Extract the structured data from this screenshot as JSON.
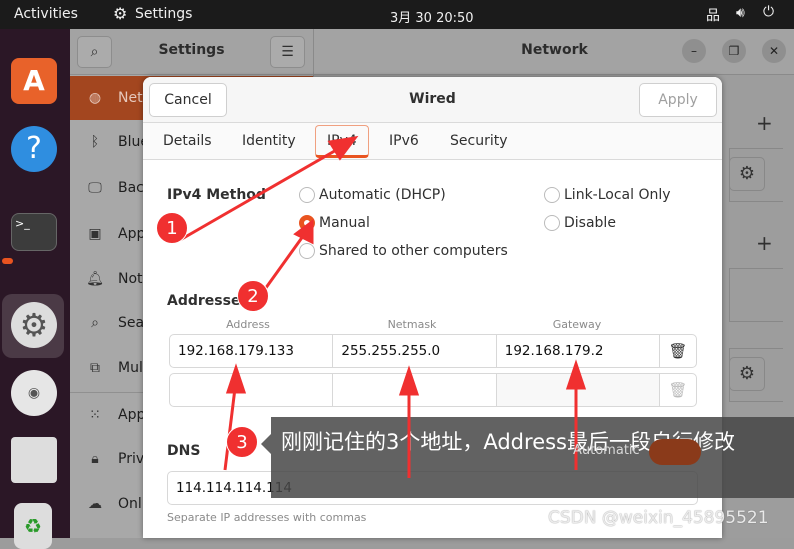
{
  "topbar": {
    "activities": "Activities",
    "app": "Settings",
    "clock": "3月 30  20:50"
  },
  "dock": {
    "items": [
      "software-icon",
      "help-icon",
      "terminal-icon",
      "settings-icon",
      "disc-icon",
      "save-icon",
      "trash-icon"
    ]
  },
  "sidebar": {
    "title": "Settings",
    "items": [
      {
        "label": "Network",
        "icon": "globe-icon"
      },
      {
        "label": "Bluetooth",
        "icon": "bluetooth-icon"
      },
      {
        "label": "Background",
        "icon": "monitor-icon"
      },
      {
        "label": "Appearance",
        "icon": "appearance-icon"
      },
      {
        "label": "Notifications",
        "icon": "bell-icon"
      },
      {
        "label": "Search",
        "icon": "search-icon"
      },
      {
        "label": "Multitasking",
        "icon": "multitasking-icon"
      },
      {
        "label": "Applications",
        "icon": "grid-icon"
      },
      {
        "label": "Privacy",
        "icon": "lock-icon"
      },
      {
        "label": "Online Accounts",
        "icon": "cloud-icon"
      }
    ]
  },
  "network": {
    "title": "Network"
  },
  "dialog": {
    "title": "Wired",
    "cancel": "Cancel",
    "apply": "Apply",
    "tabs": [
      "Details",
      "Identity",
      "IPv4",
      "IPv6",
      "Security"
    ],
    "active_tab": "IPv4",
    "method_label": "IPv4 Method",
    "methods": [
      "Automatic (DHCP)",
      "Link-Local Only",
      "Manual",
      "Disable",
      "Shared to other computers"
    ],
    "selected_method": "Manual",
    "addresses_label": "Addresses",
    "columns": [
      "Address",
      "Netmask",
      "Gateway"
    ],
    "rows": [
      [
        "192.168.179.133",
        "255.255.255.0",
        "192.168.179.2"
      ],
      [
        "",
        "",
        ""
      ]
    ],
    "dns_label": "DNS",
    "dns_auto_label": "Automatic",
    "dns_auto": false,
    "dns_value": "114.114.114.114",
    "dns_hint": "Separate IP addresses with commas"
  },
  "annotations": {
    "steps": [
      "1",
      "2",
      "3"
    ],
    "tooltip": "刚刚记住的3个地址，Address最后一段自行修改",
    "color": "#f03030"
  },
  "watermark": "CSDN @weixin_45895521"
}
